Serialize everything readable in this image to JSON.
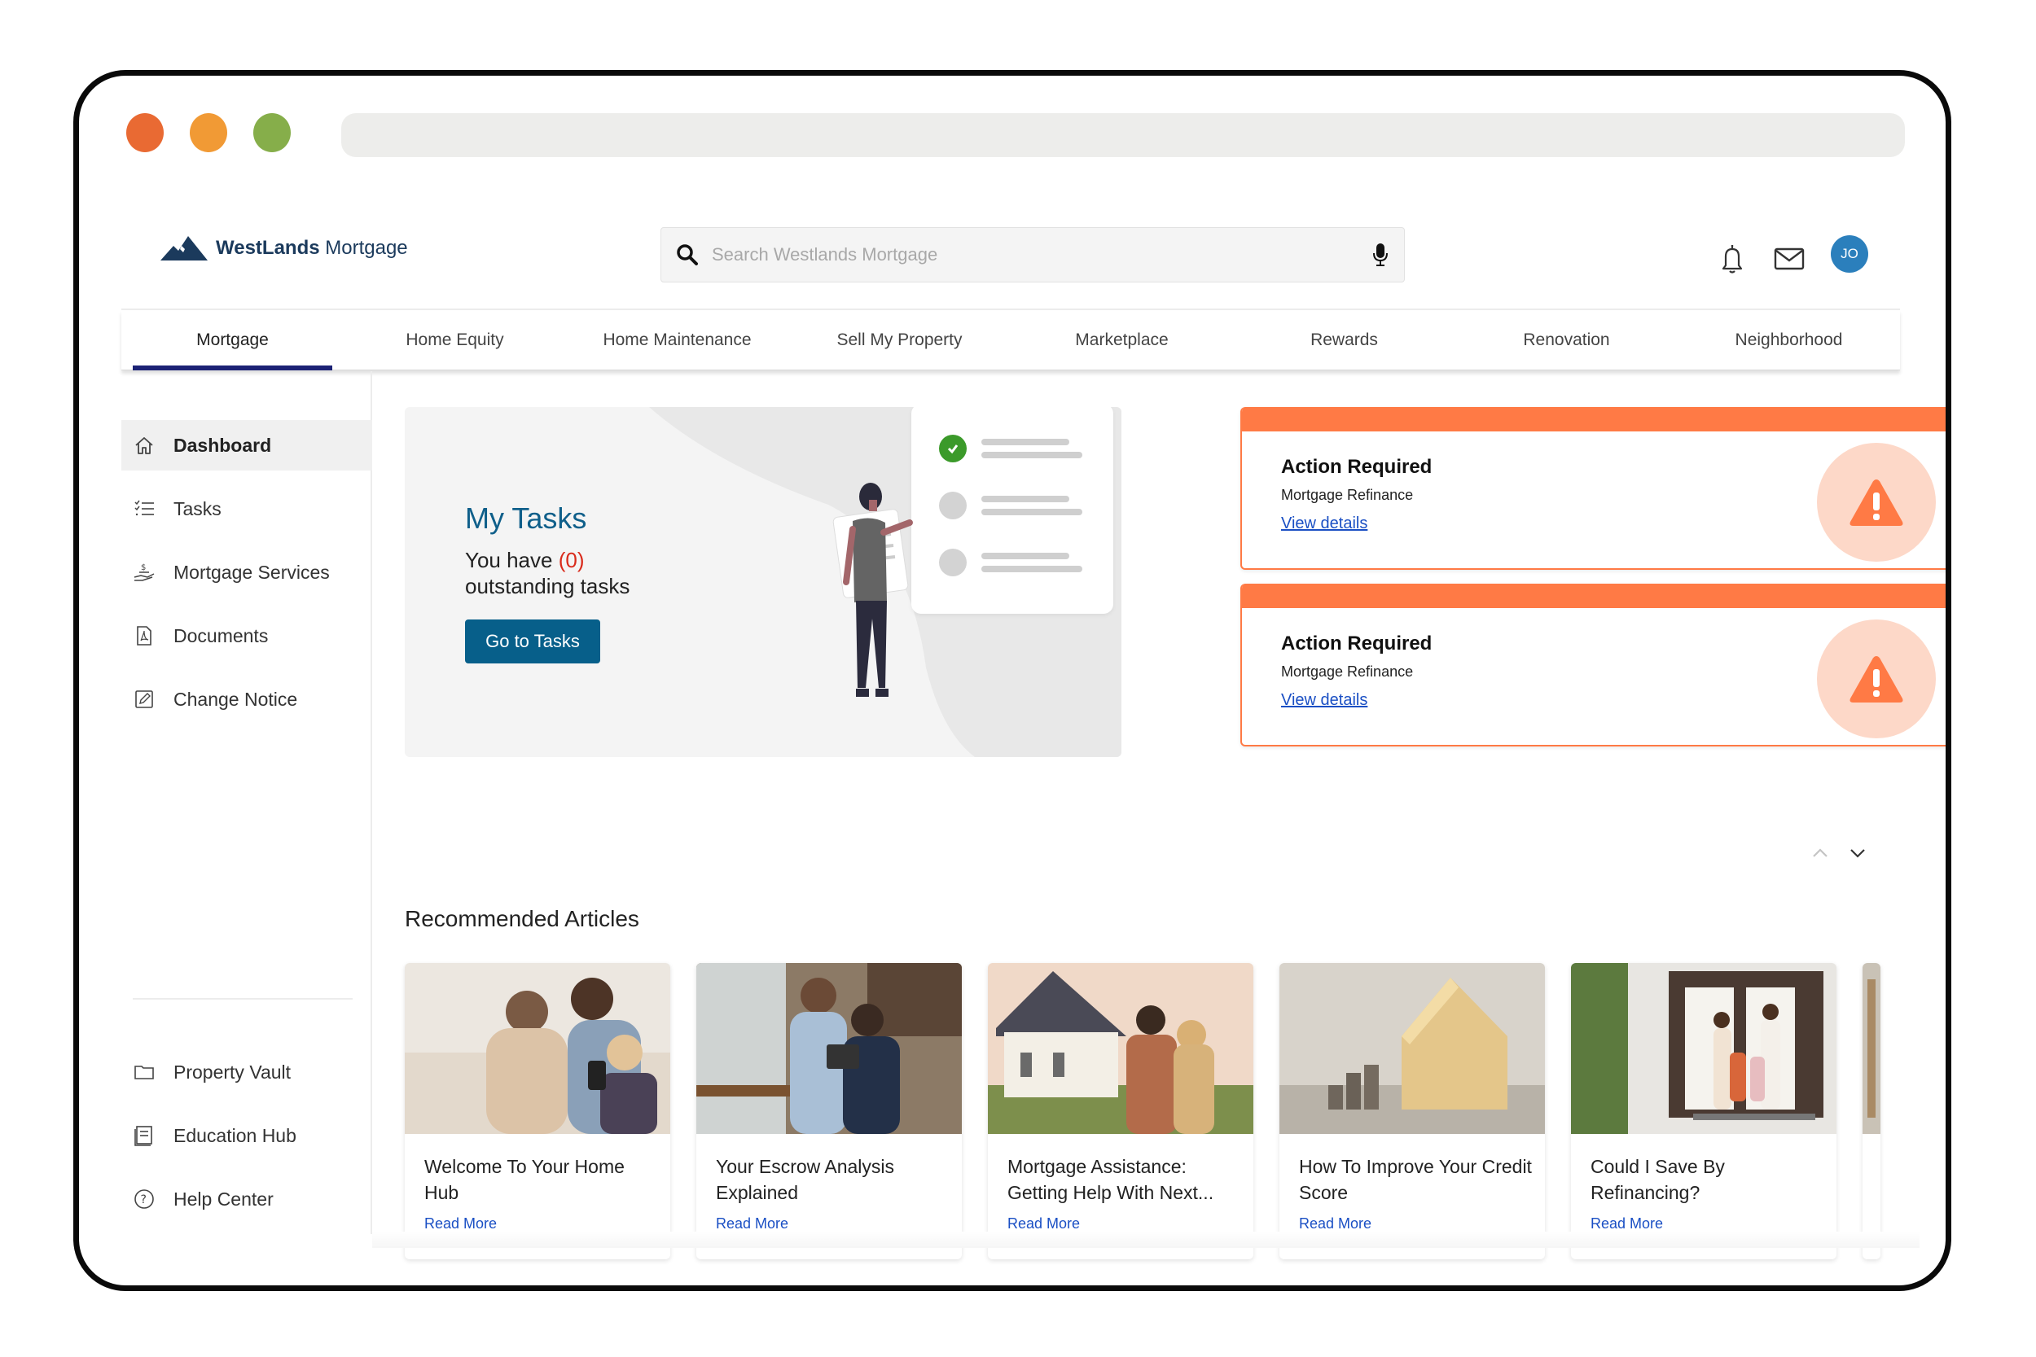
{
  "window": {
    "traffic_lights": [
      "#e96a33",
      "#f19a35",
      "#86ae4a"
    ]
  },
  "header": {
    "brand_bold": "WestLands",
    "brand_light": " Mortgage",
    "search": {
      "placeholder": "Search Westlands Mortgage",
      "value": ""
    },
    "icons": [
      "bell-icon",
      "mail-icon",
      "microphone-icon",
      "search-icon"
    ],
    "avatar_initials": "JO"
  },
  "nav": {
    "tabs": [
      {
        "label": "Mortgage",
        "active": true
      },
      {
        "label": "Home Equity"
      },
      {
        "label": "Home Maintenance"
      },
      {
        "label": "Sell My Property"
      },
      {
        "label": "Marketplace"
      },
      {
        "label": "Rewards"
      },
      {
        "label": "Renovation"
      },
      {
        "label": "Neighborhood"
      }
    ]
  },
  "sidebar": {
    "items": [
      {
        "label": "Dashboard",
        "icon": "home-icon",
        "active": true
      },
      {
        "label": "Tasks",
        "icon": "checklist-icon"
      },
      {
        "label": "Mortgage Services",
        "icon": "hand-dollar-icon"
      },
      {
        "label": "Documents",
        "icon": "pdf-document-icon"
      },
      {
        "label": "Change Notice",
        "icon": "edit-icon"
      }
    ],
    "bottom_items": [
      {
        "label": "Property Vault",
        "icon": "folder-icon"
      },
      {
        "label": "Education Hub",
        "icon": "book-icon"
      },
      {
        "label": "Help Center",
        "icon": "help-circle-icon"
      }
    ]
  },
  "tasks": {
    "title": "My Tasks",
    "line1_prefix": "You have ",
    "count": "(0)",
    "line2": "outstanding tasks",
    "button": "Go to Tasks"
  },
  "alerts": [
    {
      "title": "Action Required",
      "subtitle": "Mortgage Refinance",
      "link": "View details"
    },
    {
      "title": "Action Required",
      "subtitle": "Mortgage Refinance",
      "link": "View details"
    }
  ],
  "colors": {
    "accent_orange": "#ff7a45",
    "primary_blue": "#075f8a",
    "nav_active": "#1c2275",
    "link_blue": "#1a4fc4",
    "count_red": "#d92b1b"
  },
  "articles": {
    "title": "Recommended Articles",
    "items": [
      {
        "title": "Welcome To Your Home Hub",
        "link": "Read More",
        "image": "family-with-phone"
      },
      {
        "title": "Your Escrow Analysis Explained",
        "link": "Read More",
        "image": "couple-with-tablet"
      },
      {
        "title": "Mortgage Assistance: Getting Help With Next...",
        "link": "Read More",
        "image": "couple-facing-house"
      },
      {
        "title": "How To Improve Your Credit Score",
        "link": "Read More",
        "image": "wooden-house-and-coins"
      },
      {
        "title": "Could I Save By Refinancing?",
        "link": "Read More",
        "image": "family-at-front-door"
      }
    ]
  }
}
